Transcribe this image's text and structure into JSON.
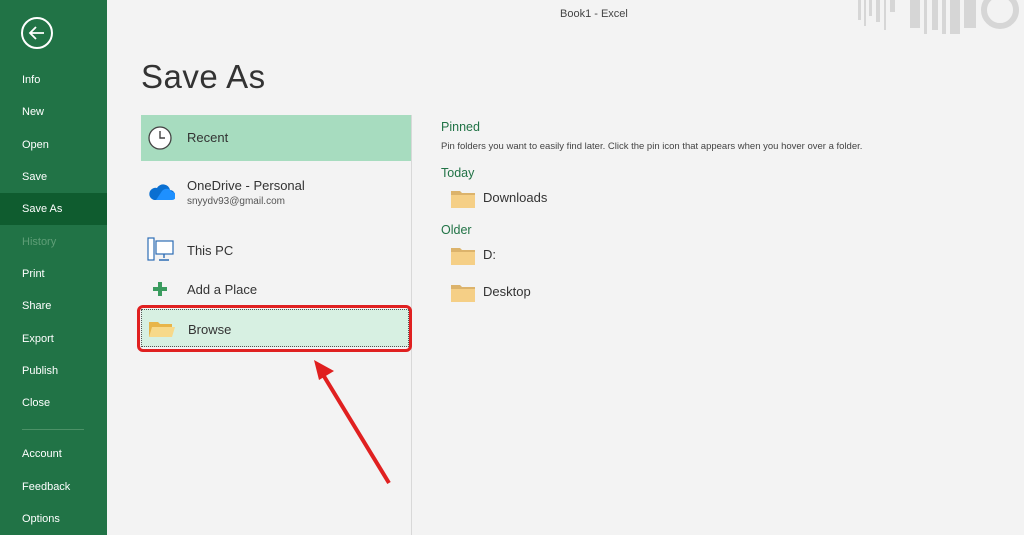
{
  "window": {
    "title": "Book1  -  Excel"
  },
  "nav": {
    "items": [
      {
        "label": "Info"
      },
      {
        "label": "New"
      },
      {
        "label": "Open"
      },
      {
        "label": "Save"
      },
      {
        "label": "Save As"
      },
      {
        "label": "History"
      },
      {
        "label": "Print"
      },
      {
        "label": "Share"
      },
      {
        "label": "Export"
      },
      {
        "label": "Publish"
      },
      {
        "label": "Close"
      },
      {
        "label": "Account"
      },
      {
        "label": "Feedback"
      },
      {
        "label": "Options"
      }
    ]
  },
  "page": {
    "title": "Save As"
  },
  "places": {
    "recent": "Recent",
    "onedrive": {
      "label": "OneDrive - Personal",
      "email": "snyydv93@gmail.com"
    },
    "this_pc": "This PC",
    "add_place": "Add a Place",
    "browse": "Browse"
  },
  "right": {
    "pinned": {
      "title": "Pinned",
      "hint": "Pin folders you want to easily find later. Click the pin icon that appears when you hover over a folder."
    },
    "today": {
      "title": "Today",
      "folders": [
        "Downloads"
      ]
    },
    "older": {
      "title": "Older",
      "folders": [
        "D:",
        "Desktop"
      ]
    }
  },
  "colors": {
    "accent": "#217346",
    "accent_dark": "#0f5c2f",
    "selected": "#a7dcbf",
    "annotation": "#e02020"
  }
}
